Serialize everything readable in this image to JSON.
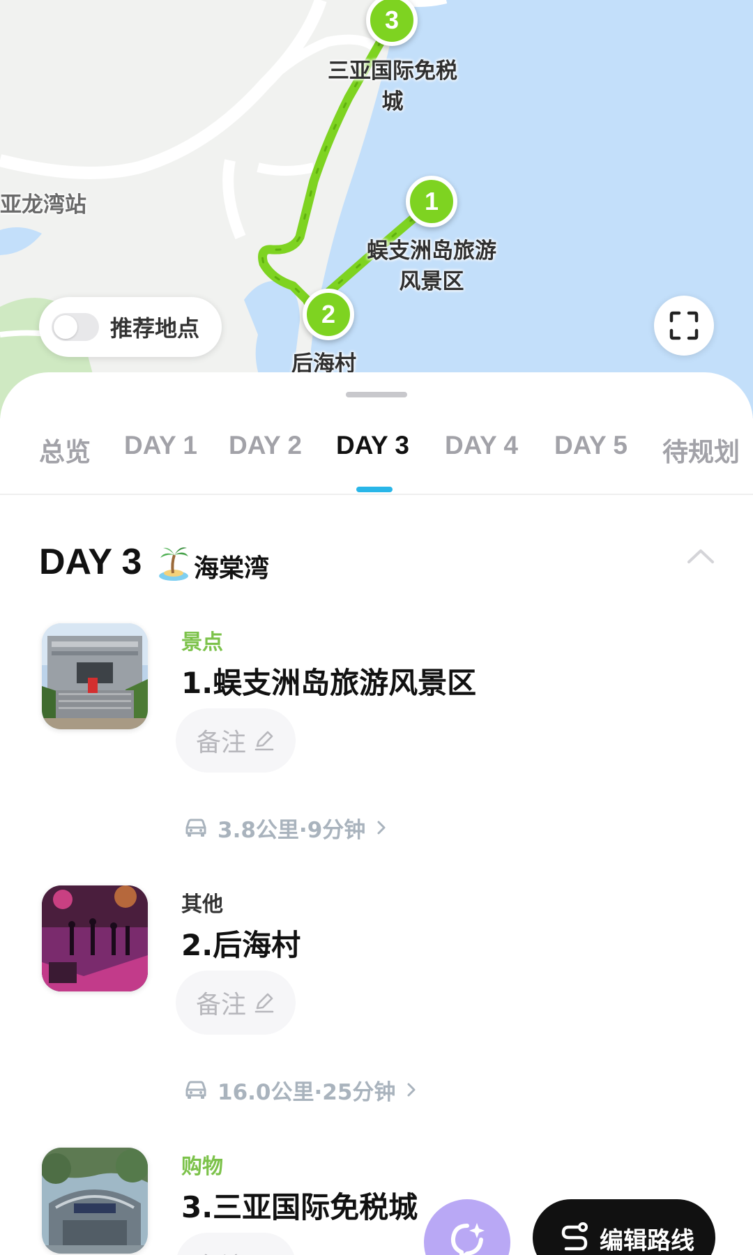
{
  "map": {
    "labels": {
      "duty_free": "三亚国际免税城",
      "wuzhizhou": "蜈支洲岛旅游风景区",
      "station": "亚龙湾站",
      "houhai": "后海村"
    },
    "markers": [
      "1",
      "2",
      "3"
    ],
    "toggle_label": "推荐地点",
    "toggle_on": false,
    "route_color": "#7ed321",
    "water_color": "#c3dffa"
  },
  "tabs": [
    {
      "label": "总览"
    },
    {
      "label": "DAY 1"
    },
    {
      "label": "DAY 2"
    },
    {
      "label": "DAY 3",
      "active": true
    },
    {
      "label": "DAY 4"
    },
    {
      "label": "DAY 5"
    },
    {
      "label": "待规划"
    }
  ],
  "day": {
    "title": "DAY 3",
    "emoji_icon": "palm-island-icon",
    "place": "海棠湾"
  },
  "pois": [
    {
      "category": "景点",
      "name": "1.蜈支洲岛旅游风景区",
      "note_label": "备注"
    },
    {
      "category": "其他",
      "name": "2.后海村",
      "note_label": "备注"
    },
    {
      "category": "购物",
      "name": "3.三亚国际免税城",
      "note_label": "备注"
    }
  ],
  "transits": [
    {
      "text": "3.8公里·9分钟"
    },
    {
      "text": "16.0公里·25分钟"
    }
  ],
  "actions": {
    "edit_route_label": "编辑路线"
  },
  "colors": {
    "accent_tab": "#29b6e8",
    "category_green": "#7cc24a",
    "route_green": "#7ed321",
    "ai_button": "#b9a8f5"
  }
}
